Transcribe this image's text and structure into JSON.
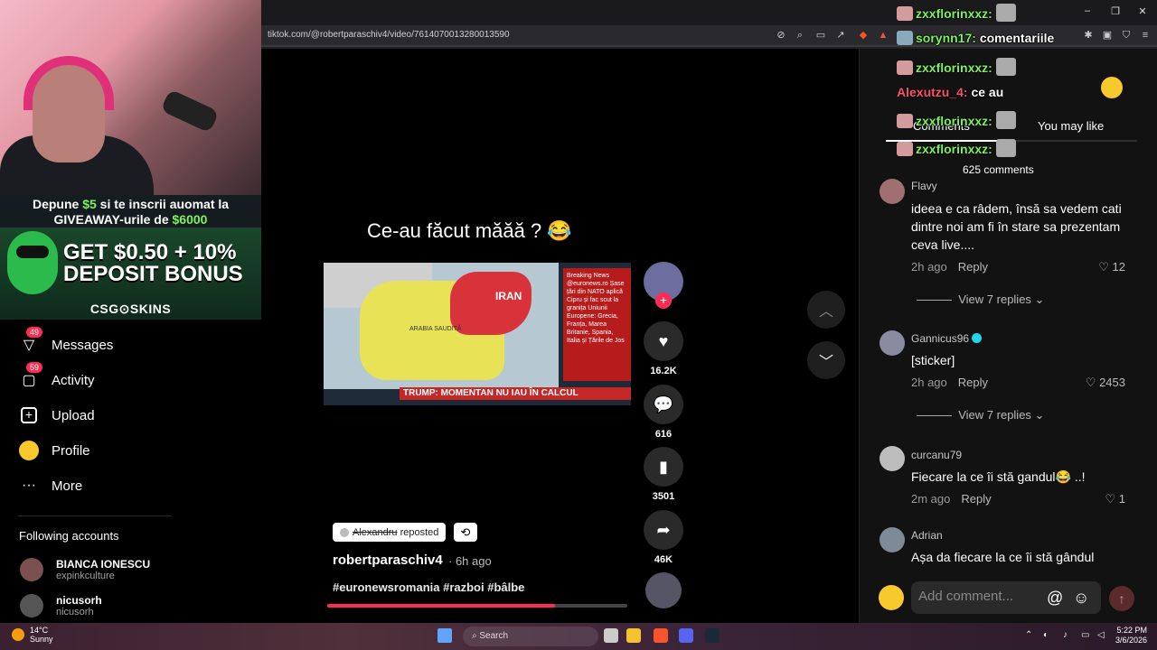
{
  "browser": {
    "url": "tiktok.com/@robertparaschiv4/video/7614070013280013590"
  },
  "stream": {
    "ad": {
      "line1_pre": "Depune ",
      "line1_amount": "$5",
      "line1_post": " si te inscrii auomat la",
      "line2_pre": "GIVEAWAY-urile de ",
      "line2_amount": "$6000",
      "big1": "GET $0.50 + 10%",
      "big2": "DEPOSIT BONUS",
      "brand": "CSG⊙SKINS"
    },
    "chat": [
      {
        "user": "zxxflorinxxz:",
        "msg": "",
        "color": "green"
      },
      {
        "user": "sorynn17:",
        "msg": "comentariile",
        "color": "green"
      },
      {
        "user": "zxxflorinxxz:",
        "msg": "",
        "color": "green"
      },
      {
        "user": "Alexutzu_4:",
        "msg": "ce au",
        "color": "red"
      },
      {
        "user": "zxxflorinxxz:",
        "msg": "",
        "color": "green"
      },
      {
        "user": "zxxflorinxxz:",
        "msg": "",
        "color": "green"
      }
    ]
  },
  "sidebar": {
    "items": [
      {
        "label": "Messages",
        "badge": "49",
        "icon": "send-icon"
      },
      {
        "label": "Activity",
        "badge": "59",
        "icon": "inbox-icon"
      },
      {
        "label": "Upload",
        "badge": "",
        "icon": "upload-icon"
      },
      {
        "label": "Profile",
        "badge": "",
        "icon": "profile-avatar-icon"
      },
      {
        "label": "More",
        "badge": "",
        "icon": "more-icon"
      }
    ],
    "following_title": "Following accounts",
    "accounts": [
      {
        "name": "BIANCA IONESCU",
        "handle": "expinkculture"
      },
      {
        "name": "nicusorh",
        "handle": "nicusorh"
      }
    ]
  },
  "video": {
    "caption": "Ce-au făcut măăă ? 😂",
    "map_label_iran": "IRAN",
    "map_label_arabia": "ARABIA SAUDITĂ",
    "news_box": "Breaking News @euronews.ro Șase țări din NATO aplică Cipru și fac scut la granița Uniunii Europene: Grecia, Franța, Marea Britanie, Spania, Italia și Țările de Jos",
    "ticker": "TRUMP: MOMENTAN NU IAU ÎN CALCUL",
    "progress": 0.76,
    "likes": "16.2K",
    "comments": "616",
    "saves": "3501",
    "shares": "46K",
    "repost_user": "Alexandru",
    "repost_label": "reposted",
    "author": "robertparaschiv4",
    "posted": "· 6h ago",
    "tags": "#euronewsromania #razboi #bâlbe"
  },
  "comments_panel": {
    "tab_comments": "Comments",
    "tab_you_may_like": "You may like",
    "count_text": "625 comments",
    "comments": [
      {
        "user": "Flavy",
        "text": "ideea e ca râdem, însă sa vedem cati dintre noi am fi în stare sa prezentam ceva live....",
        "time": "2h ago",
        "reply": "Reply",
        "likes": "12",
        "view_replies": "View 7 replies"
      },
      {
        "user": "Gannicus96",
        "text": "[sticker]",
        "time": "2h ago",
        "reply": "Reply",
        "likes": "2453",
        "view_replies": "View 7 replies"
      },
      {
        "user": "curcanu79",
        "text": "Fiecare la ce îi stă gandul😂 ..!",
        "time": "2m ago",
        "reply": "Reply",
        "likes": "1"
      },
      {
        "user": "Adrian",
        "text": "Așa da fiecare la ce îi stă gândul"
      }
    ],
    "add_placeholder": "Add comment..."
  },
  "taskbar": {
    "weather_temp": "14°C",
    "weather_text": "Sunny",
    "search": "Search",
    "time": "5:22 PM",
    "date": "3/6/2026"
  },
  "colors": {
    "accent": "#fe2c55",
    "chat_user": "#7cf35a",
    "chat_user_alt": "#ff4f6d"
  }
}
